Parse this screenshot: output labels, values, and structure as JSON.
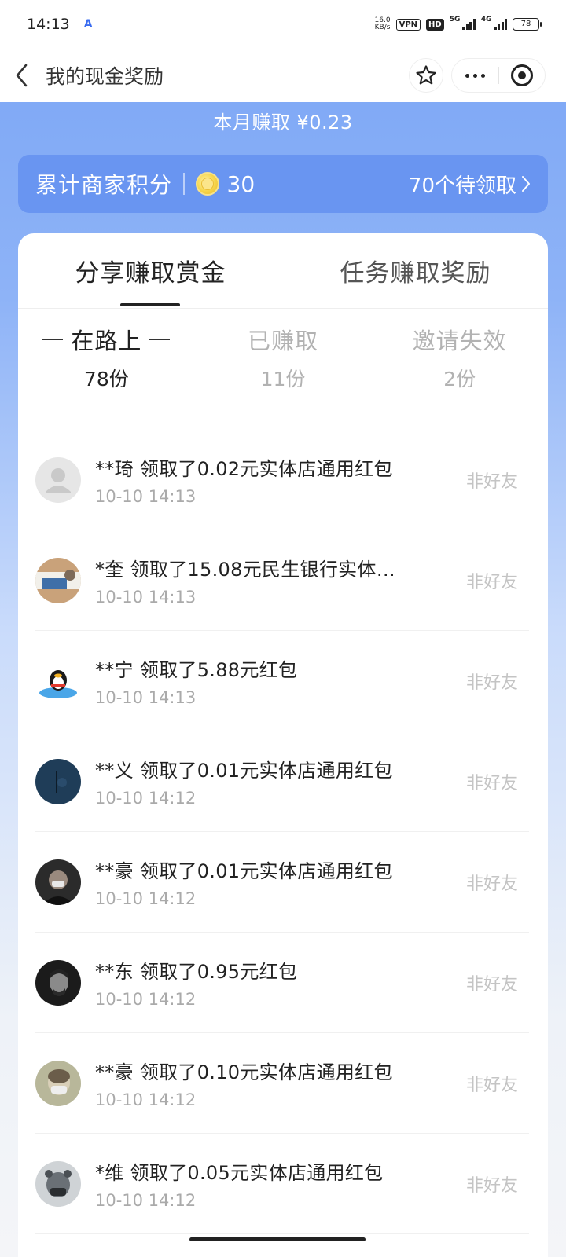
{
  "status_bar": {
    "time": "14:13",
    "app_icon": "A",
    "speed_value": "16.0",
    "speed_unit": "KB/s",
    "vpn": "VPN",
    "hd": "HD",
    "net1": "5G",
    "net2": "4G",
    "battery": "78"
  },
  "nav": {
    "title": "我的现金奖励",
    "icons": [
      "back-arrow-icon",
      "star-icon",
      "more-icon",
      "target-icon"
    ]
  },
  "summary": {
    "month_earn": "本月赚取 ¥0.23",
    "points_label": "累计商家积分",
    "points_value": "30",
    "pending": "70个待领取"
  },
  "main_tabs": [
    {
      "label": "分享赚取赏金",
      "active": true
    },
    {
      "label": "任务赚取奖励",
      "active": false
    }
  ],
  "sub_tabs": [
    {
      "label": "在路上",
      "count": "78份",
      "active": true
    },
    {
      "label": "已赚取",
      "count": "11份",
      "active": false
    },
    {
      "label": "邀请失效",
      "count": "2份",
      "active": false
    }
  ],
  "records": [
    {
      "title": "**琦 领取了0.02元实体店通用红包",
      "time": "10-10 14:13",
      "status": "非好友",
      "avatar": "default"
    },
    {
      "title": "*奎 领取了15.08元民生银行实体店...",
      "time": "10-10 14:13",
      "status": "非好友",
      "avatar": "photo-bed"
    },
    {
      "title": "**宁 领取了5.88元红包",
      "time": "10-10 14:13",
      "status": "非好友",
      "avatar": "penguin"
    },
    {
      "title": "**义 领取了0.01元实体店通用红包",
      "time": "10-10 14:12",
      "status": "非好友",
      "avatar": "photo-dark-blue"
    },
    {
      "title": "**豪 领取了0.01元实体店通用红包",
      "time": "10-10 14:12",
      "status": "非好友",
      "avatar": "photo-mask"
    },
    {
      "title": "**东 领取了0.95元红包",
      "time": "10-10 14:12",
      "status": "非好友",
      "avatar": "photo-bw"
    },
    {
      "title": "**豪 领取了0.10元实体店通用红包",
      "time": "10-10 14:12",
      "status": "非好友",
      "avatar": "photo-blur"
    },
    {
      "title": "*维 领取了0.05元实体店通用红包",
      "time": "10-10 14:12",
      "status": "非好友",
      "avatar": "photo-hat"
    }
  ]
}
